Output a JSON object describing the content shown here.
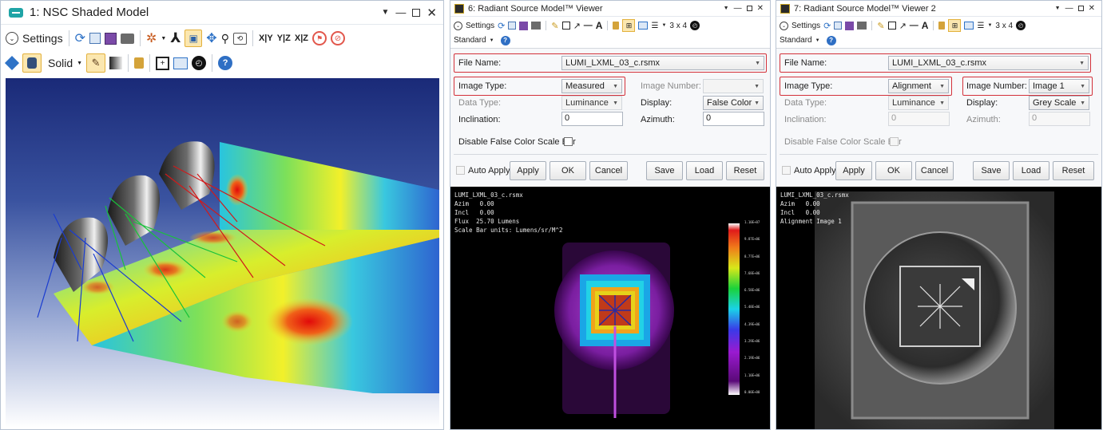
{
  "left": {
    "title": "1: NSC Shaded Model",
    "settings_label": "Settings",
    "toolbar_row1": [
      "refresh-icon",
      "copy-icon",
      "save-icon",
      "print-icon",
      "rotate-icon",
      "axes-icon",
      "zoom-window-icon",
      "pan-icon",
      "zoom-icon",
      "reset-view-icon"
    ],
    "view_labels": [
      "X|Y",
      "Y|Z",
      "X|Z"
    ],
    "render_mode": "Solid",
    "colors": {
      "bg_top": "#1c2d7a",
      "bg_bottom": "#ffffff",
      "accent": "#2f73c7"
    }
  },
  "viewer1": {
    "title": "6: Radiant Source Model™ Viewer",
    "settings_label": "Settings",
    "grid_label": "3 x 4",
    "standard_label": "Standard",
    "file_name_label": "File Name:",
    "file_name_value": "LUMI_LXML_03_c.rsmx",
    "image_type_label": "Image Type:",
    "image_type_value": "Measured",
    "image_number_label": "Image Number:",
    "image_number_value": "",
    "data_type_label": "Data Type:",
    "data_type_value": "Luminance",
    "display_label": "Display:",
    "display_value": "False Color",
    "inclination_label": "Inclination:",
    "inclination_value": "0",
    "azimuth_label": "Azimuth:",
    "azimuth_value": "0",
    "disable_scale_label": "Disable False Color Scale Bar",
    "auto_apply_label": "Auto Apply",
    "buttons": [
      "Apply",
      "OK",
      "Cancel",
      "Save",
      "Load",
      "Reset"
    ],
    "overlay": [
      "LUMI_LXML_03_c.rsmx",
      "Azim   0.00",
      "Incl   0.00",
      "Flux  25.70 Lumens",
      "Scale Bar units: Lumens/sr/M^2"
    ],
    "scale_ticks": [
      "1.10E+07",
      "9.87E+06",
      "8.77E+06",
      "7.68E+06",
      "6.58E+06",
      "5.48E+06",
      "4.39E+06",
      "3.29E+06",
      "2.19E+06",
      "1.10E+06",
      "0.00E+00"
    ]
  },
  "viewer2": {
    "title": "7: Radiant Source Model™ Viewer 2",
    "settings_label": "Settings",
    "grid_label": "3 x 4",
    "standard_label": "Standard",
    "file_name_label": "File Name:",
    "file_name_value": "LUMI_LXML_03_c.rsmx",
    "image_type_label": "Image Type:",
    "image_type_value": "Alignment",
    "image_number_label": "Image Number:",
    "image_number_value": "Image 1",
    "data_type_label": "Data Type:",
    "data_type_value": "Luminance",
    "display_label": "Display:",
    "display_value": "Grey Scale",
    "inclination_label": "Inclination:",
    "inclination_value": "0",
    "azimuth_label": "Azimuth:",
    "azimuth_value": "0",
    "disable_scale_label": "Disable False Color Scale Bar",
    "auto_apply_label": "Auto Apply",
    "buttons": [
      "Apply",
      "OK",
      "Cancel",
      "Save",
      "Load",
      "Reset"
    ],
    "overlay": [
      "LUMI_LXML_03_c.rsmx",
      "Azim   0.00",
      "Incl   0.00",
      "Alignment Image 1"
    ]
  }
}
